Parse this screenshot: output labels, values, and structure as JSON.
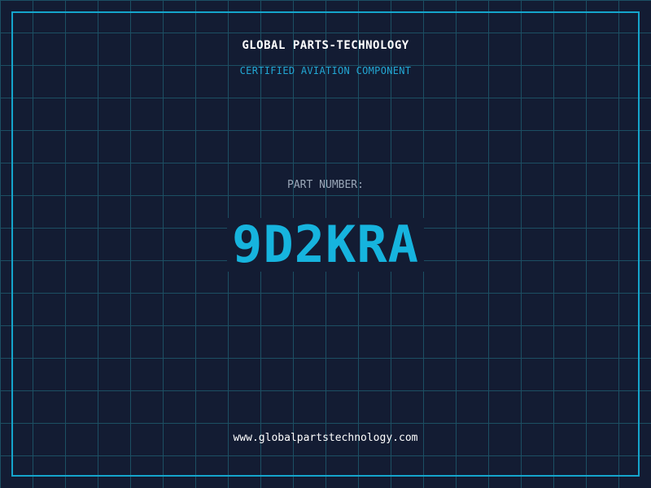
{
  "brand": {
    "name": "GLOBAL PARTS-TECHNOLOGY",
    "tagline": "CERTIFIED AVIATION COMPONENT"
  },
  "part": {
    "label": "PART NUMBER:",
    "number": "9D2KRA"
  },
  "footer": {
    "website": "www.globalpartstechnology.com"
  },
  "colors": {
    "background": "#131c33",
    "grid": "#1c4f63",
    "accent": "#16b4de",
    "frame": "#15a5cc"
  }
}
